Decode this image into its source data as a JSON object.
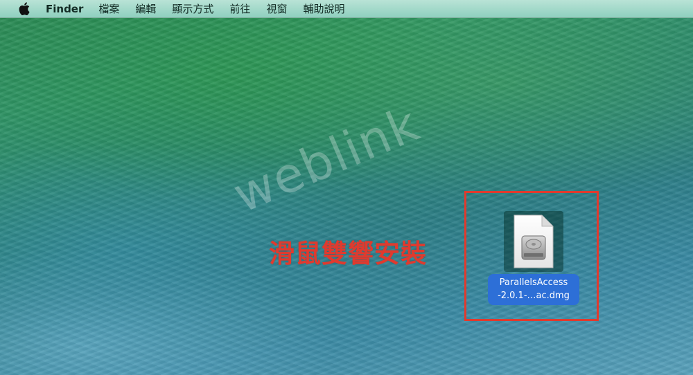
{
  "menubar": {
    "apple_icon": "apple-logo-icon",
    "app_name": "Finder",
    "items": [
      "檔案",
      "編輯",
      "顯示方式",
      "前往",
      "視窗",
      "輔助說明"
    ]
  },
  "desktop": {
    "watermark": "weblink",
    "annotation": "滑鼠雙響安裝",
    "annotation_color": "#e03a2e",
    "file": {
      "icon": "disk-image-file-icon",
      "name_line1": "ParallelsAccess",
      "name_line2": "-2.0.1-…ac.dmg",
      "selection_color": "#2d6fd7"
    }
  }
}
